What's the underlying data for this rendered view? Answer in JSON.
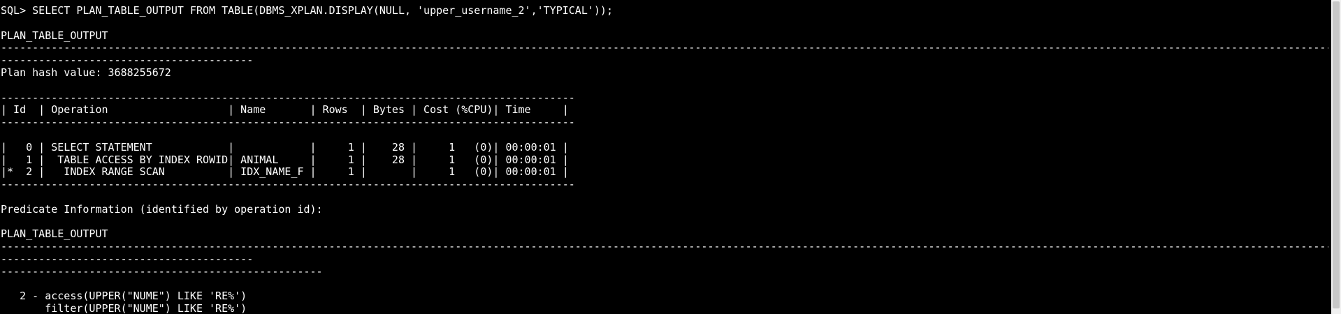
{
  "terminal": {
    "colors": {
      "background": "#000000",
      "foreground": "#ffffff"
    },
    "lines": {
      "command": "SQL> SELECT PLAN_TABLE_OUTPUT FROM TABLE(DBMS_XPLAN.DISPLAY(NULL, 'upper_username_2','TYPICAL'));",
      "output_header_1": "PLAN_TABLE_OUTPUT",
      "long_dashes": "--------------------------------------------------------------------------------------------------------------------------------------------------------------------------------------------------------------------------------------------------------------------------------------------",
      "wrap_dashes": "----------------------------------------",
      "plan_hash": "Plan hash value: 3688255672",
      "table_border": "-------------------------------------------------------------------------------------------",
      "table_header": "| Id  | Operation                   | Name       | Rows  | Bytes | Cost (%CPU)| Time     |",
      "row_0": "|   0 | SELECT STATEMENT            |            |     1 |    28 |     1   (0)| 00:00:01 |",
      "row_1": "|   1 |  TABLE ACCESS BY INDEX ROWID| ANIMAL     |     1 |    28 |     1   (0)| 00:00:01 |",
      "row_2": "|*  2 |   INDEX RANGE SCAN          | IDX_NAME_F |     1 |       |     1   (0)| 00:00:01 |",
      "predicate_title": "Predicate Information (identified by operation id):",
      "output_header_2": "PLAN_TABLE_OUTPUT",
      "predicate_dashes": "---------------------------------------------------",
      "predicate_access": "   2 - access(UPPER(\"NUME\") LIKE 'RE%')",
      "predicate_filter": "       filter(UPPER(\"NUME\") LIKE 'RE%')"
    }
  }
}
